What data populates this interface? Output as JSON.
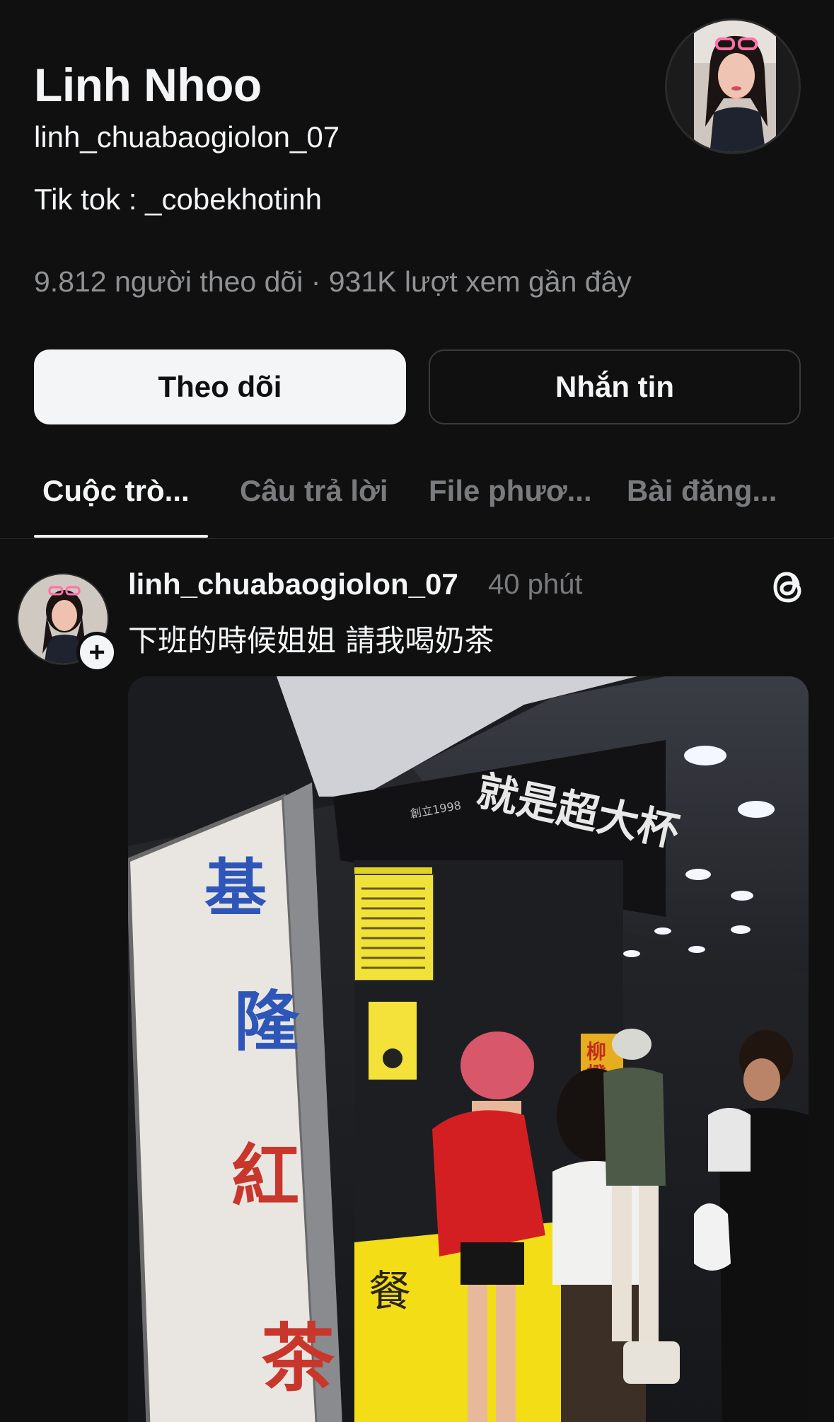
{
  "profile": {
    "display_name": "Linh Nhoo",
    "username": "linh_chuabaogiolon_07",
    "bio": "Tik tok : _cobekhotinh",
    "stats": "9.812 người theo dõi · 931K lượt xem gần đây"
  },
  "actions": {
    "follow_label": "Theo dõi",
    "message_label": "Nhắn tin"
  },
  "tabs": [
    {
      "label": "Cuộc trò..."
    },
    {
      "label": "Câu trả lời"
    },
    {
      "label": "File phươ..."
    },
    {
      "label": "Bài đăng..."
    }
  ],
  "post": {
    "username": "linh_chuabaogiolon_07",
    "time": "40 phút",
    "text": "下班的時候姐姐 請我喝奶茶",
    "image_sign": {
      "vertical_chars": [
        "基",
        "隆",
        "紅",
        "茶"
      ],
      "banner": "就是超大杯",
      "banner_small": "創立1998",
      "counter": "餐",
      "side_sign": "柳橙汁"
    }
  },
  "colors": {
    "background": "#101010",
    "primary_text": "#f3f5f7",
    "secondary_text": "#8f9194",
    "follow_button_bg": "#f3f5f7",
    "divider": "#2e2e2e"
  },
  "icons": {
    "post_logo": "threads-icon",
    "follow_badge": "plus-icon"
  }
}
